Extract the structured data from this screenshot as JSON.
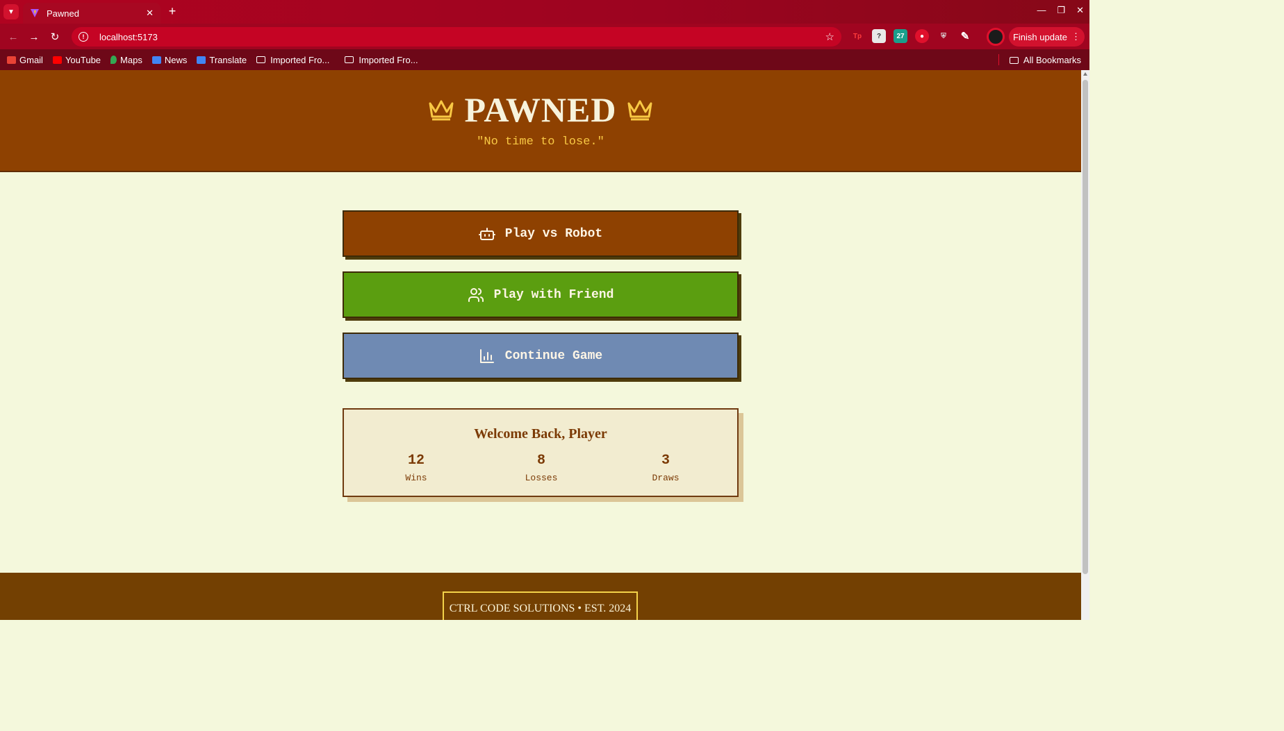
{
  "browser": {
    "tab_title": "Pawned",
    "url": "localhost:5173",
    "finish_update_label": "Finish update",
    "bookmarks": [
      {
        "label": "Gmail",
        "color": "#ea4335"
      },
      {
        "label": "YouTube",
        "color": "#ff0000"
      },
      {
        "label": "Maps",
        "color": "#34a853"
      },
      {
        "label": "News",
        "color": "#4285f4"
      },
      {
        "label": "Translate",
        "color": "#4285f4"
      },
      {
        "label": "Imported Fro...",
        "color": ""
      },
      {
        "label": "Imported Fro...",
        "color": ""
      }
    ],
    "all_bookmarks_label": "All Bookmarks"
  },
  "hero": {
    "title": "PAWNED",
    "tagline": "\"No time to lose.\""
  },
  "menu": {
    "play_robot": "Play vs Robot",
    "play_friend": "Play with Friend",
    "continue_game": "Continue Game"
  },
  "stats": {
    "title": "Welcome Back, Player",
    "items": [
      {
        "value": "12",
        "label": "Wins"
      },
      {
        "value": "8",
        "label": "Losses"
      },
      {
        "value": "3",
        "label": "Draws"
      }
    ]
  },
  "footer": {
    "text": "CTRL CODE SOLUTIONS • EST. 2024"
  },
  "colors": {
    "brand_brown": "#8e4101",
    "friend_green": "#5b9e10",
    "continue_blue": "#6f8ab3",
    "crown_yellow": "#f8c844",
    "page_bg": "#f4f8dc"
  }
}
